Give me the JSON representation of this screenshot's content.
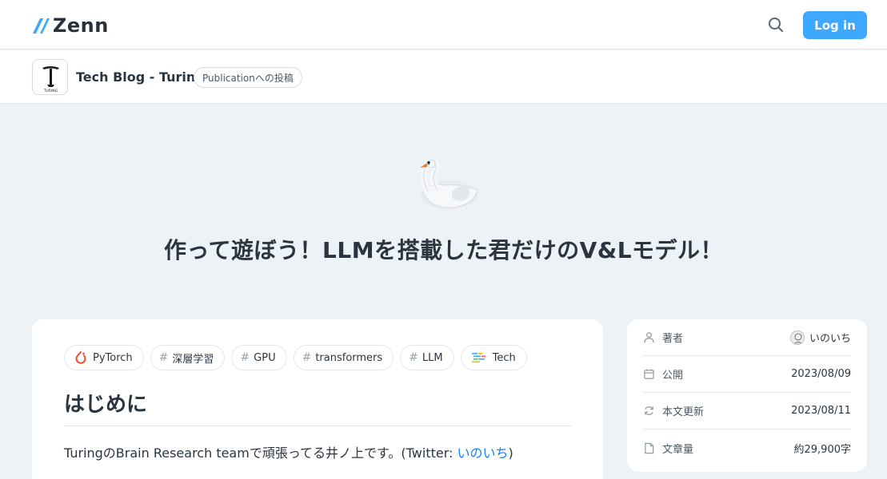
{
  "header": {
    "brand": "Zenn",
    "login_label": "Log in",
    "search_icon": "search-icon"
  },
  "publication": {
    "name": "Tech Blog - Turing",
    "badge": "Publicationへの投稿",
    "logo_text": "TURING"
  },
  "article": {
    "emoji": "swan",
    "title": "作って遊ぼう！LLMを搭載した君だけのV&Lモデル！",
    "topics": [
      {
        "label": "PyTorch",
        "icon": "pytorch-icon"
      },
      {
        "label": "深層学習",
        "icon": "hash"
      },
      {
        "label": "GPU",
        "icon": "hash"
      },
      {
        "label": "transformers",
        "icon": "hash"
      },
      {
        "label": "LLM",
        "icon": "hash"
      },
      {
        "label": "Tech",
        "icon": "tech-icon"
      }
    ],
    "section_heading": "はじめに",
    "intro_prefix": "TuringのBrain Research teamで頑張ってる井ノ上です。(Twitter: ",
    "intro_link": "いのいち",
    "intro_suffix": ")"
  },
  "sidebar": {
    "meta": [
      {
        "label": "著者",
        "value": "いのいち",
        "icon": "user-icon"
      },
      {
        "label": "公開",
        "value": "2023/08/09",
        "icon": "calendar-icon"
      },
      {
        "label": "本文更新",
        "value": "2023/08/11",
        "icon": "refresh-icon"
      },
      {
        "label": "文章量",
        "value": "約29,900字",
        "icon": "document-icon"
      }
    ]
  },
  "colors": {
    "accent": "#3ea8ff",
    "link": "#0f83fd",
    "background": "#edf2f7"
  }
}
